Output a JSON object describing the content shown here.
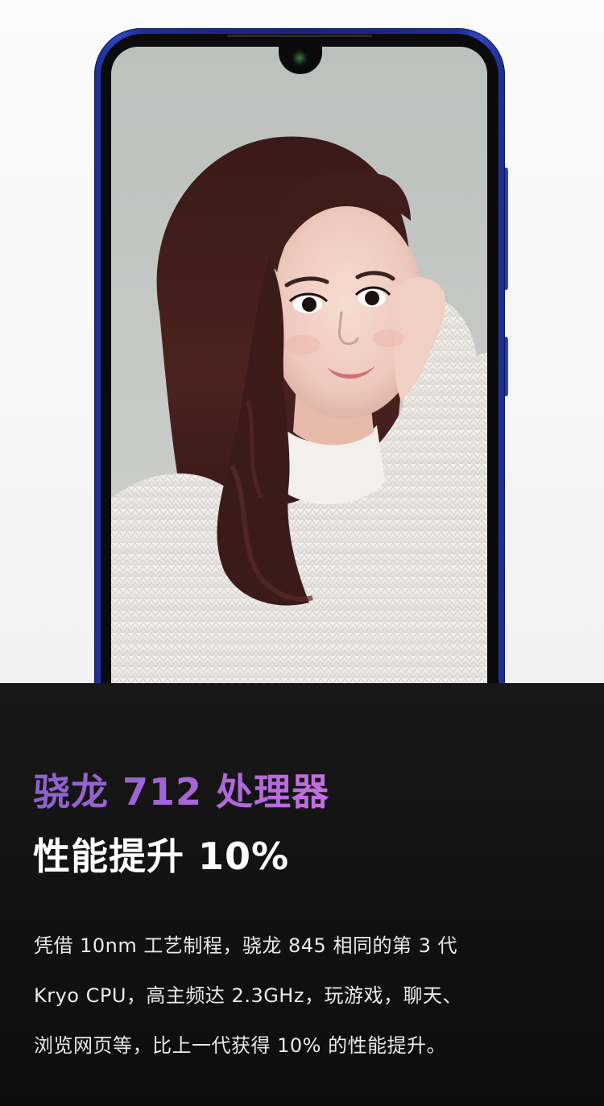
{
  "product_section": {
    "headline_1": "骁龙 712 处理器",
    "headline_2": "性能提升 10%",
    "body_lines": [
      "凭借 10nm 工艺制程，骁龙 845 相同的第 3 代",
      "Kryo CPU，高主频达 2.3GHz，玩游戏，聊天、",
      "浏览网页等，比上一代获得 10% 的性能提升。"
    ]
  },
  "colors": {
    "phone_frame": "#1f2f9a",
    "headline_1_gradient_start": "#8a62cc",
    "headline_1_gradient_end": "#c56ee0",
    "headline_2": "#ffffff",
    "body_text": "#e9e9e9",
    "dark_background": "#141414",
    "light_background": "#f6f6f6"
  },
  "icons": {
    "front_camera": "front-camera-icon"
  }
}
